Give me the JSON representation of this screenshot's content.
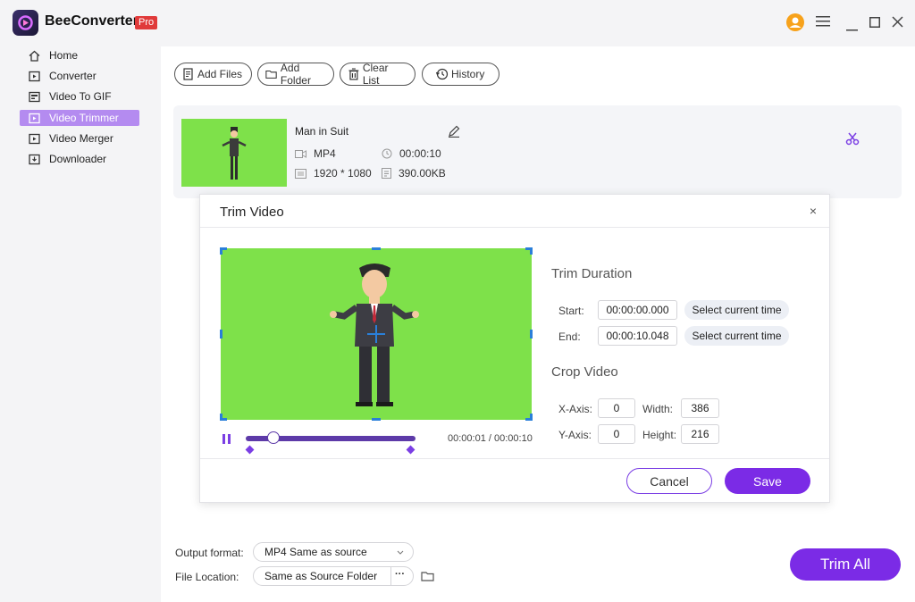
{
  "app": {
    "name": "BeeConverter",
    "badge": "Pro"
  },
  "sidebar": {
    "items": [
      {
        "label": "Home",
        "icon": "home-icon"
      },
      {
        "label": "Converter",
        "icon": "converter-icon"
      },
      {
        "label": "Video To GIF",
        "icon": "gif-icon"
      },
      {
        "label": "Video Trimmer",
        "icon": "trimmer-icon",
        "active": true
      },
      {
        "label": "Video Merger",
        "icon": "merger-icon"
      },
      {
        "label": "Downloader",
        "icon": "download-icon"
      }
    ]
  },
  "toolbar": {
    "add_files": "Add Files",
    "add_folder": "Add Folder",
    "clear_list": "Clear List",
    "history": "History"
  },
  "file": {
    "name": "Man in Suit",
    "format": "MP4",
    "duration": "00:00:10",
    "resolution": "1920 * 1080",
    "size": "390.00KB"
  },
  "dialog": {
    "title": "Trim Video",
    "close": "×",
    "timecode": "00:00:01 / 00:00:10",
    "playback_progress": 0.1,
    "trim_duration": {
      "title": "Trim Duration",
      "start_label": "Start:",
      "start_value": "00:00:00.000",
      "end_label": "End:",
      "end_value": "00:00:10.048",
      "select_current": "Select current time"
    },
    "crop": {
      "title": "Crop Video",
      "x_label": "X-Axis:",
      "x_value": "0",
      "y_label": "Y-Axis:",
      "y_value": "0",
      "width_label": "Width:",
      "width_value": "386",
      "height_label": "Height:",
      "height_value": "216"
    },
    "cancel": "Cancel",
    "save": "Save"
  },
  "bottom": {
    "output_format_label": "Output format:",
    "output_format_value": "MP4 Same as source",
    "file_location_label": "File Location:",
    "file_location_value": "Same as Source Folder",
    "more": "···",
    "trim_all": "Trim All"
  },
  "colors": {
    "accent": "#7b2be6",
    "active_sidebar": "#b48bf0",
    "green_screen": "#7ee14a",
    "crop_handle": "#2a7fd9",
    "pro_badge": "#e03a3a"
  }
}
